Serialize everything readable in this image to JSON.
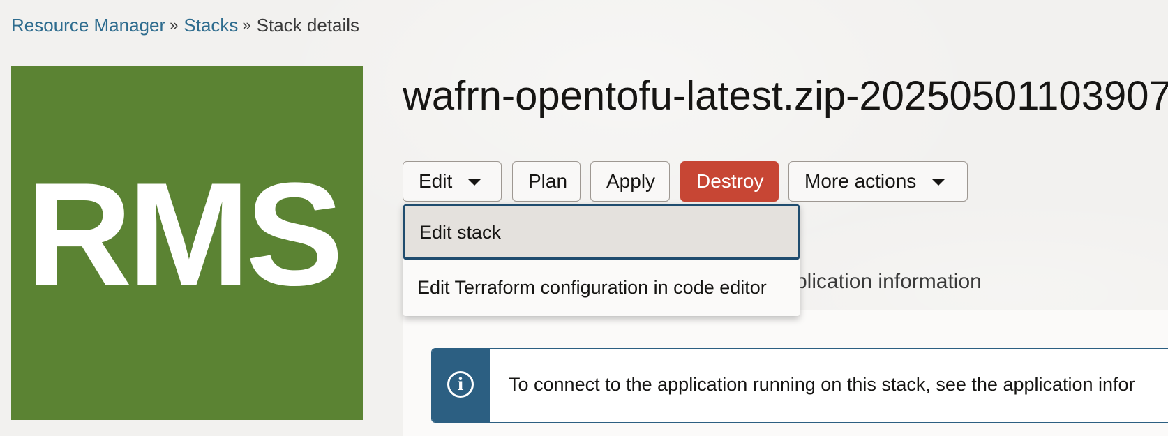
{
  "breadcrumb": {
    "items": [
      "Resource Manager",
      "Stacks"
    ],
    "separator": "»",
    "current": "Stack details"
  },
  "logo": {
    "text": "RMS",
    "color": "#5b8333"
  },
  "stack": {
    "title": "wafrn-opentofu-latest.zip-20250501103907"
  },
  "toolbar": {
    "edit_label": "Edit",
    "plan_label": "Plan",
    "apply_label": "Apply",
    "destroy_label": "Destroy",
    "more_actions_label": "More actions"
  },
  "edit_menu": {
    "items": [
      "Edit stack",
      "Edit Terraform configuration in code editor"
    ],
    "highlighted_index": 0
  },
  "tabs": {
    "partial_label": "plication information"
  },
  "info_banner": {
    "text": "To connect to the application running on this stack, see the application infor"
  },
  "colors": {
    "link": "#2e6c8e",
    "destroy": "#c74634",
    "info": "#2c5f82"
  }
}
